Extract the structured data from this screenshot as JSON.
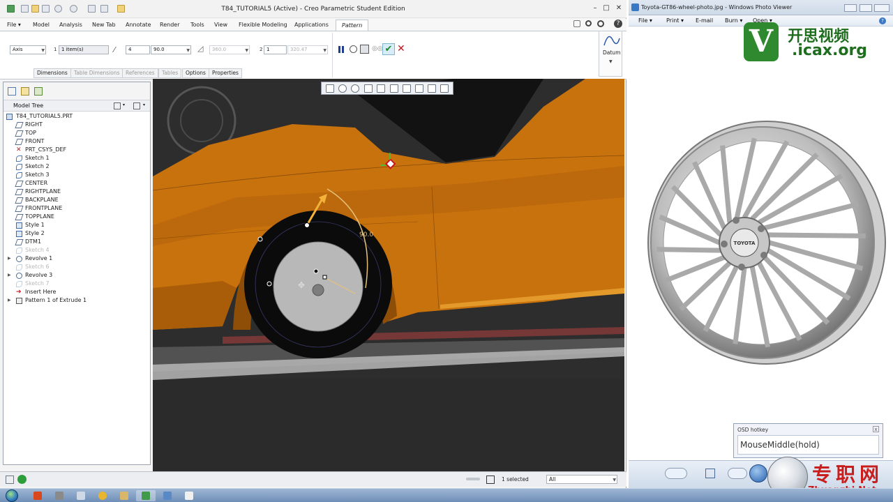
{
  "creo": {
    "window_title": "T84_TUTORIAL5 (Active) - Creo Parametric Student Edition",
    "window_controls": [
      "–",
      "□",
      "✕"
    ],
    "ribbon_tabs": [
      "File",
      "Model",
      "Analysis",
      "New Tab",
      "Annotate",
      "Render",
      "Tools",
      "View",
      "Flexible Modeling",
      "Applications",
      "Pattern"
    ],
    "active_tab": "Pattern",
    "pattern": {
      "type": "Axis",
      "dir1_index": "1",
      "dir1_items": "1 item(s)",
      "members": "4",
      "angle": "90.0",
      "angular_extent": "360.0",
      "dir2_index": "2",
      "dir2_members": "1",
      "dir2_angle": "320.47"
    },
    "subtabs": [
      "Dimensions",
      "Table Dimensions",
      "References",
      "Tables",
      "Options",
      "Properties"
    ],
    "subtabs_disabled": [
      "Table Dimensions",
      "References",
      "Tables"
    ],
    "datum_label": "Datum",
    "model_tree": {
      "header": "Model Tree",
      "root": "T84_TUTORIAL5.PRT",
      "items": [
        {
          "label": "RIGHT",
          "icon": "datum-plane-icon",
          "dim": false
        },
        {
          "label": "TOP",
          "icon": "datum-plane-icon",
          "dim": false
        },
        {
          "label": "FRONT",
          "icon": "datum-plane-icon",
          "dim": false
        },
        {
          "label": "PRT_CSYS_DEF",
          "icon": "csys-icon",
          "dim": false
        },
        {
          "label": "Sketch 1",
          "icon": "sketch-icon",
          "dim": false
        },
        {
          "label": "Sketch 2",
          "icon": "sketch-icon",
          "dim": false
        },
        {
          "label": "Sketch 3",
          "icon": "sketch-icon",
          "dim": false
        },
        {
          "label": "CENTER",
          "icon": "datum-plane-icon",
          "dim": false
        },
        {
          "label": "RIGHTPLANE",
          "icon": "datum-plane-icon",
          "dim": false
        },
        {
          "label": "BACKPLANE",
          "icon": "datum-plane-icon",
          "dim": false
        },
        {
          "label": "FRONTPLANE",
          "icon": "datum-plane-icon",
          "dim": false
        },
        {
          "label": "TOPPLANE",
          "icon": "datum-plane-icon",
          "dim": false
        },
        {
          "label": "Style 1",
          "icon": "style-icon",
          "dim": false
        },
        {
          "label": "Style 2",
          "icon": "style-icon",
          "dim": false
        },
        {
          "label": "DTM1",
          "icon": "datum-plane-icon",
          "dim": false
        },
        {
          "label": "Sketch 4",
          "icon": "sketch-icon",
          "dim": true
        },
        {
          "label": "Revolve 1",
          "icon": "revolve-icon",
          "dim": false
        },
        {
          "label": "Sketch 6",
          "icon": "sketch-icon",
          "dim": true
        },
        {
          "label": "Revolve 3",
          "icon": "revolve-icon",
          "dim": false
        },
        {
          "label": "Sketch 7",
          "icon": "sketch-icon",
          "dim": true
        },
        {
          "label": "Insert Here",
          "icon": "insert-arrow-icon",
          "dim": false
        },
        {
          "label": "Pattern 1 of Extrude 1",
          "icon": "pattern-icon",
          "dim": false
        }
      ]
    },
    "viewport": {
      "angle_label": "90.0",
      "colors": {
        "body": "#c8720e",
        "body_dark": "#8e4e08",
        "tire": "#0b0b0b",
        "rim": "#b4b4b4",
        "floor": "#2b2b2b"
      }
    },
    "status": {
      "selected": "1 selected",
      "filter": "All"
    }
  },
  "photo_viewer": {
    "window_title": "Toyota-GT86-wheel-photo.jpg - Windows Photo Viewer",
    "menu": [
      "File",
      "Print",
      "E-mail",
      "Burn",
      "Open"
    ],
    "hub_text": "TOYOTA",
    "osd_title": "OSD hotkey",
    "osd_text": "MouseMiddle(hold)"
  },
  "watermarks": {
    "icax_letter": "V",
    "icax_cn": "开思视频",
    "icax_url": ".icax.org",
    "zz_cn": "专职网",
    "zz_url": "Zhuanzhi.Net"
  },
  "taskbar": {
    "apps": [
      "vlc-icon",
      "tools-icon",
      "explorer-icon",
      "chrome-icon",
      "folder-icon",
      "creo-icon",
      "photo-icon",
      "notepad-icon"
    ]
  }
}
